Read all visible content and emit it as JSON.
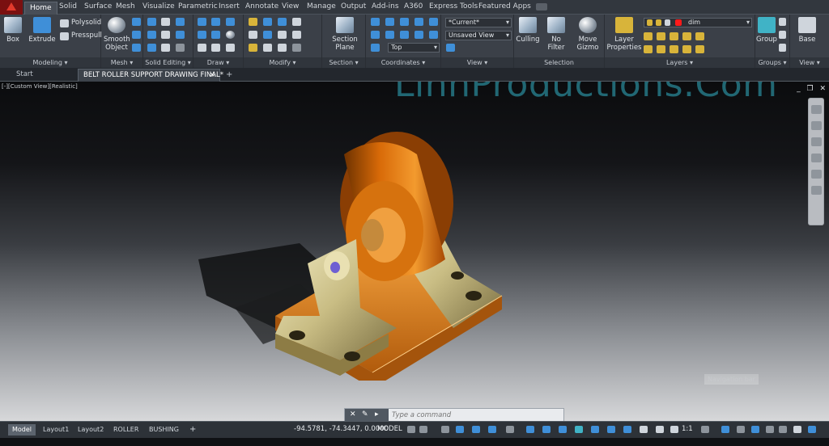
{
  "ribbon_tabs": [
    "Home",
    "Solid",
    "Surface",
    "Mesh",
    "Visualize",
    "Parametric",
    "Insert",
    "Annotate",
    "View",
    "Manage",
    "Output",
    "Add-ins",
    "A360",
    "Express Tools",
    "Featured Apps"
  ],
  "modeling": {
    "box": "Box",
    "extrude": "Extrude",
    "polysolid": "Polysolid",
    "presspull": "Presspull",
    "label": "Modeling"
  },
  "mesh": {
    "smooth_object_1": "Smooth",
    "smooth_object_2": "Object",
    "label": "Mesh"
  },
  "panels": {
    "solid_editing": "Solid Editing",
    "draw": "Draw",
    "modify": "Modify",
    "section": "Section",
    "coordinates": "Coordinates",
    "view": "View",
    "selection": "Selection",
    "layers": "Layers",
    "groups": "Groups",
    "view2": "View"
  },
  "section": {
    "plane_1": "Section",
    "plane_2": "Plane"
  },
  "view_panel": {
    "visual_style": "*Current*",
    "named_view": "Unsaved View",
    "view_direction": "Top"
  },
  "selection": {
    "culling": "Culling",
    "no_filter": "No Filter",
    "move_gizmo_1": "Move",
    "move_gizmo_2": "Gizmo"
  },
  "layers": {
    "layer_properties_1": "Layer",
    "layer_properties_2": "Properties",
    "current_layer": "dim"
  },
  "groups": {
    "group": "Group"
  },
  "base": {
    "label": "Base"
  },
  "doc_tabs": {
    "start": "Start",
    "drawing": "BELT ROLLER SUPPORT DRAWING FINAL*"
  },
  "viewport": {
    "label": "[-][Custom View][Realistic]",
    "watermark": "LinhProductions.Com",
    "nav_hint": "Navigation bar"
  },
  "command": {
    "placeholder": "Type a command"
  },
  "layout_tabs": [
    "Model",
    "Layout1",
    "Layout2",
    "ROLLER",
    "BUSHING"
  ],
  "status": {
    "coordinates": "-94.5781, -74.3447, 0.0000",
    "space": "MODEL",
    "scale": "1:1"
  },
  "colors": {
    "accent": "#3f8fd8",
    "part_orange": "#e07a12",
    "part_gold": "#cfc490",
    "watermark": "#2ea0b2"
  }
}
